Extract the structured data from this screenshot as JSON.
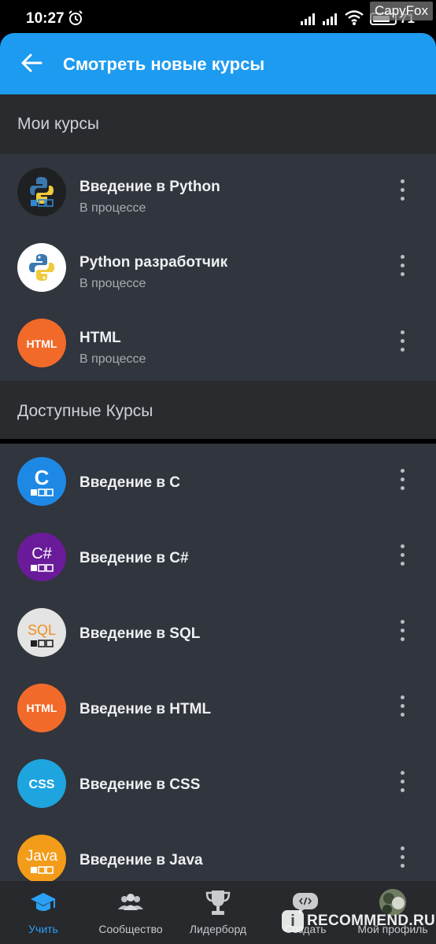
{
  "status_bar": {
    "time": "10:27",
    "battery": "71",
    "watermark": "CapyFox"
  },
  "app_bar": {
    "title": "Смотреть новые курсы"
  },
  "my_courses": {
    "header": "Мои курсы",
    "items": [
      {
        "title": "Введение в Python",
        "status": "В процессе",
        "logo": "python-dark-logo-icon"
      },
      {
        "title": "Python разработчик",
        "status": "В процессе",
        "logo": "python-logo-icon"
      },
      {
        "title": "HTML",
        "status": "В процессе",
        "logo_text": "HTML",
        "logo": "html-logo-icon"
      }
    ]
  },
  "available_courses": {
    "header": "Доступные Курсы",
    "items": [
      {
        "title": "Введение в C",
        "logo_text": "C",
        "logo": "c-logo-icon"
      },
      {
        "title": "Введение в C#",
        "logo_text": "C#",
        "logo": "csharp-logo-icon"
      },
      {
        "title": "Введение в SQL",
        "logo_text": "SQL",
        "logo": "sql-logo-icon"
      },
      {
        "title": "Введение в HTML",
        "logo_text": "HTML",
        "logo": "html-logo-icon"
      },
      {
        "title": "Введение в CSS",
        "logo_text": "CSS",
        "logo": "css-logo-icon"
      },
      {
        "title": "Введение в Java",
        "logo_text": "Java",
        "logo": "java-logo-icon"
      }
    ]
  },
  "bottom_nav": {
    "items": [
      {
        "label": "Учить",
        "icon": "graduation-cap-icon",
        "active": true
      },
      {
        "label": "Сообщество",
        "icon": "people-icon"
      },
      {
        "label": "Лидерборд",
        "icon": "trophy-icon"
      },
      {
        "label": "Создать",
        "icon": "code-bubble-icon"
      },
      {
        "label": "Мой профиль",
        "icon": "avatar"
      }
    ]
  },
  "watermark_bottom": {
    "badge": "i",
    "text": "RECOMMEND.RU"
  },
  "colors": {
    "accent": "#1d9bf0",
    "background": "#31353d",
    "section_header": "#292b2f",
    "nav_active": "#2aa1f5",
    "c": "#1e88e5",
    "csharp": "#6a1b9a",
    "html": "#f26a2a",
    "css": "#1ea5e0",
    "java": "#f39c1a",
    "sql_text": "#f08c1e"
  }
}
